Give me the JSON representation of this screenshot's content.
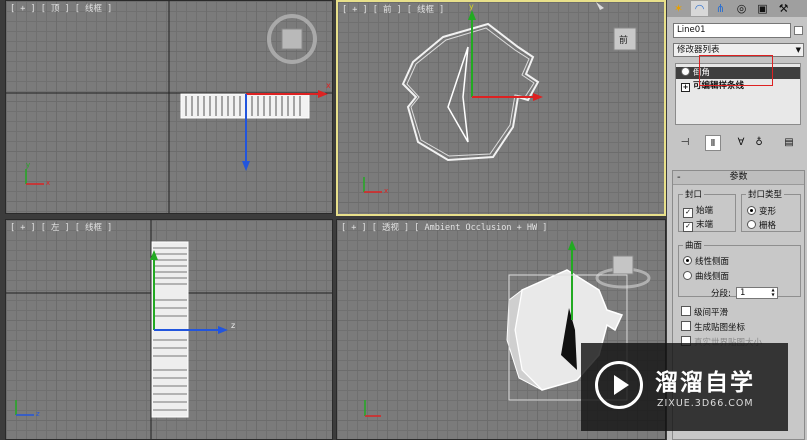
{
  "viewports": {
    "top": {
      "label": "[ + ] [ 顶 ] [ 线框 ]"
    },
    "front": {
      "label": "[ + ] [ 前 ] [ 线框 ]"
    },
    "left": {
      "label": "[ + ] [ 左 ] [ 线框 ]"
    },
    "persp": {
      "label": "[ + ] [ 透视 ] [ Ambient Occlusion + HW ]"
    }
  },
  "axes": {
    "x": "x",
    "y": "y",
    "z": "z"
  },
  "viewcube": {
    "front_face": "前"
  },
  "command_panel": {
    "tab_icons": [
      "create-icon",
      "modify-icon",
      "hierarchy-icon",
      "motion-icon",
      "display-icon",
      "utilities-icon"
    ],
    "object_name": "Line01",
    "modifier_list": "修改器列表",
    "stack": [
      {
        "label": "倒角",
        "selected": true
      },
      {
        "label": "可编辑样条线",
        "selected": false
      }
    ]
  },
  "parameters": {
    "title": "参数",
    "cap_group": "封口",
    "cap_start": "始端",
    "cap_end": "末端",
    "cap_type_group": "封口类型",
    "morph": "变形",
    "grid": "栅格",
    "surface_group": "曲面",
    "linear_sides": "线性侧面",
    "curved_sides": "曲线侧面",
    "segments_label": "分段:",
    "segments_value": "1",
    "smooth_across_levels": "级间平滑",
    "gen_mapping": "生成贴图坐标",
    "real_world_map": "真实世界贴图大小"
  },
  "watermark": {
    "title": "溜溜自学",
    "url": "ZIXUE.3D66.COM"
  }
}
